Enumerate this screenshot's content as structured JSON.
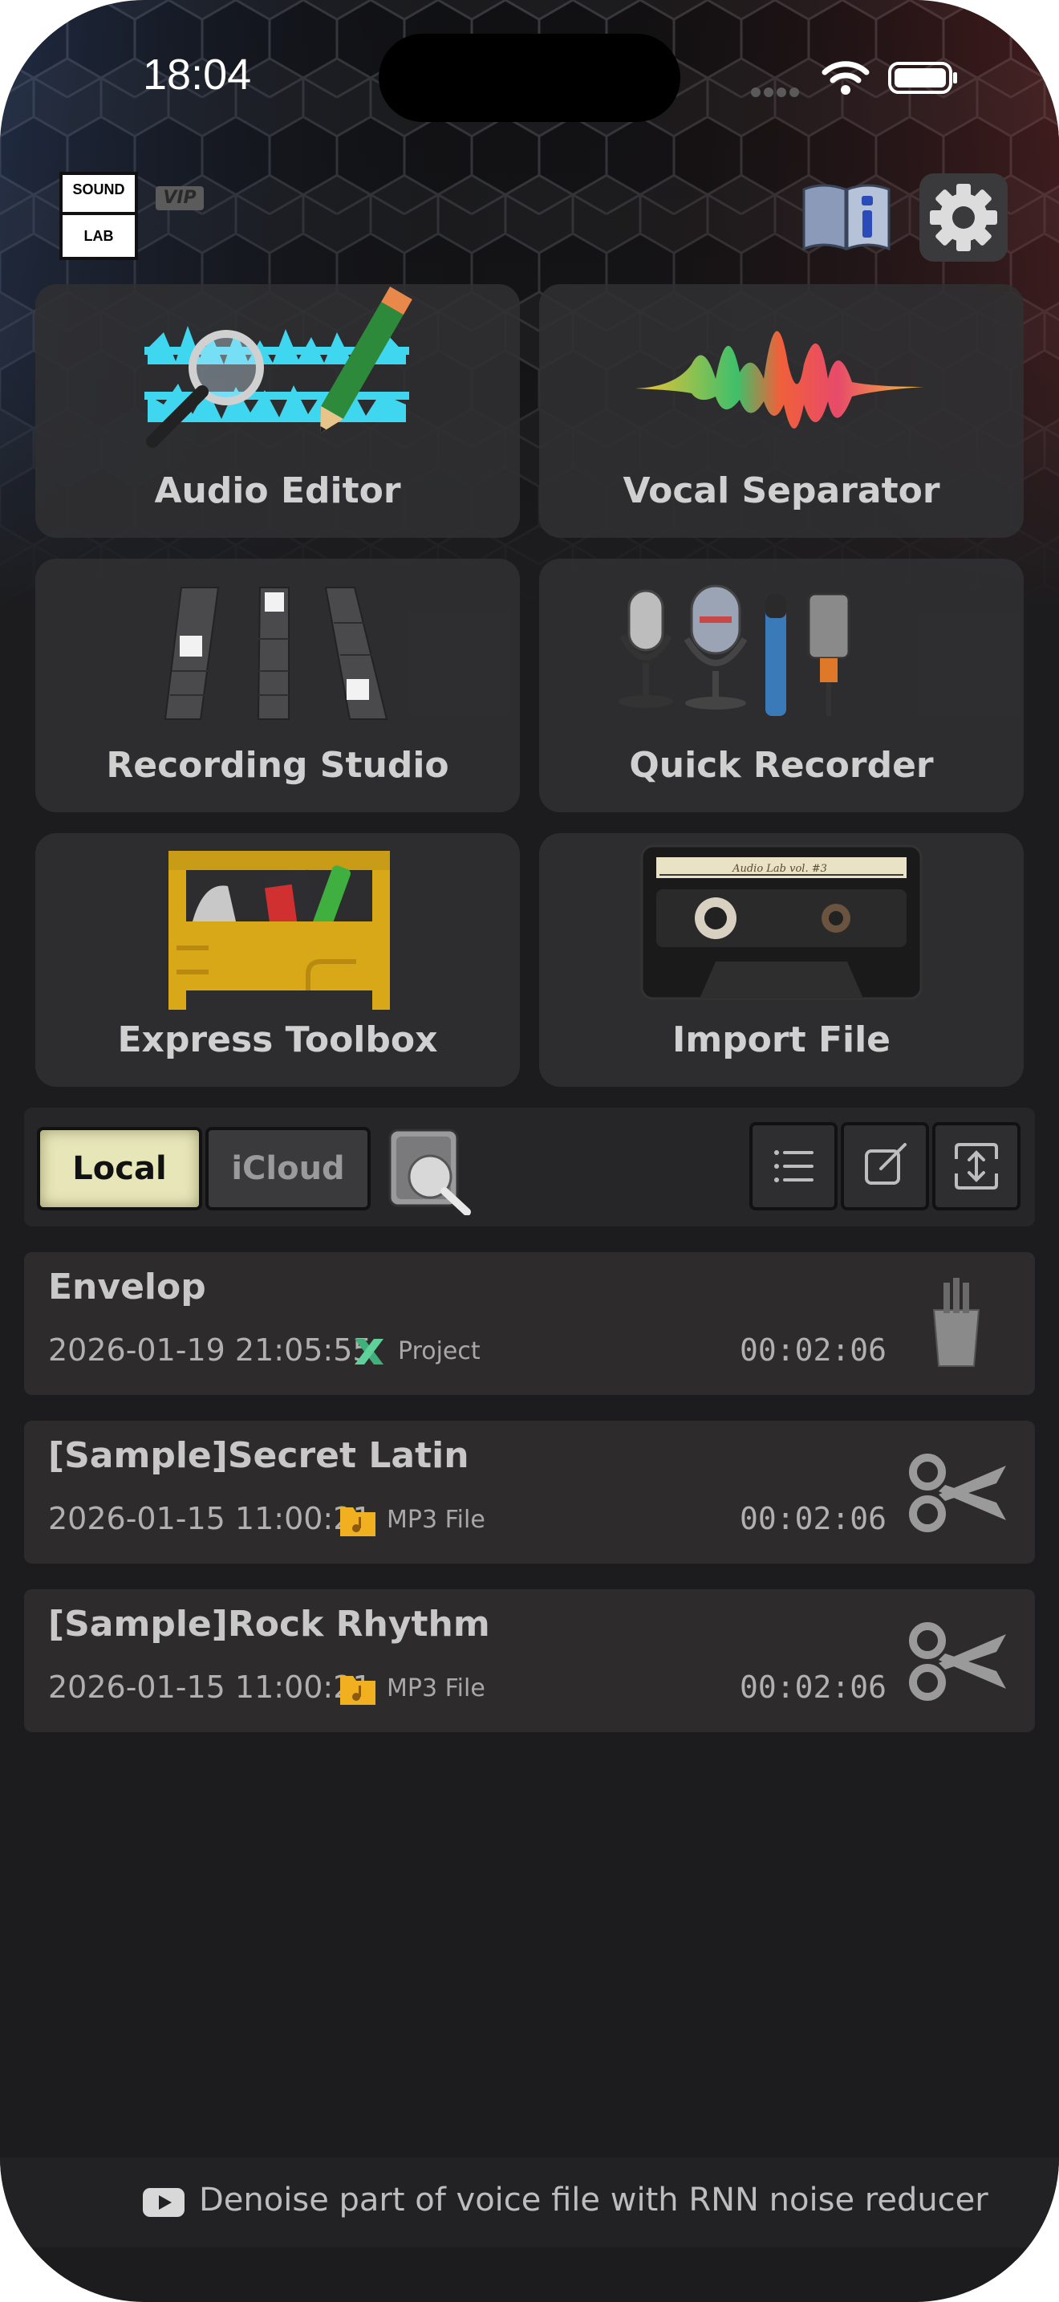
{
  "status_bar": {
    "time": "18:04"
  },
  "header": {
    "logo_top": "SOUND",
    "logo_bottom": "LAB",
    "vip_badge": "VIP"
  },
  "tiles": [
    {
      "label": "Audio Editor",
      "icon": "audio-editor-icon"
    },
    {
      "label": "Vocal Separator",
      "icon": "waveform-icon"
    },
    {
      "label": "Recording Studio",
      "icon": "mixer-faders-icon"
    },
    {
      "label": "Quick Recorder",
      "icon": "microphones-icon"
    },
    {
      "label": "Express Toolbox",
      "icon": "toolbox-icon"
    },
    {
      "label": "Import File",
      "icon": "cassette-icon"
    }
  ],
  "storage_tabs": {
    "local": "Local",
    "icloud": "iCloud",
    "selected": "Local"
  },
  "files": [
    {
      "name": "Envelop",
      "date": "2026-01-19 21:05:55",
      "type": "Project",
      "type_icon": "project-icon",
      "duration": "00:02:06",
      "action_icon": "pencil-cup-icon"
    },
    {
      "name": "[Sample]Secret Latin",
      "date": "2026-01-15 11:00:21",
      "type": "MP3 File",
      "type_icon": "music-folder-icon",
      "duration": "00:02:06",
      "action_icon": "scissors-icon"
    },
    {
      "name": "[Sample]Rock Rhythm",
      "date": "2026-01-15 11:00:21",
      "type": "MP3 File",
      "type_icon": "music-folder-icon",
      "duration": "00:02:06",
      "action_icon": "scissors-icon"
    }
  ],
  "tip": {
    "text": "Denoise part of voice file with RNN noise reducer",
    "icon": "youtube-icon"
  },
  "colors": {
    "background": "#1c1c1e",
    "tile": "#303032",
    "selected_tab": "#e7e6b8",
    "row": "#2d2b2b"
  }
}
